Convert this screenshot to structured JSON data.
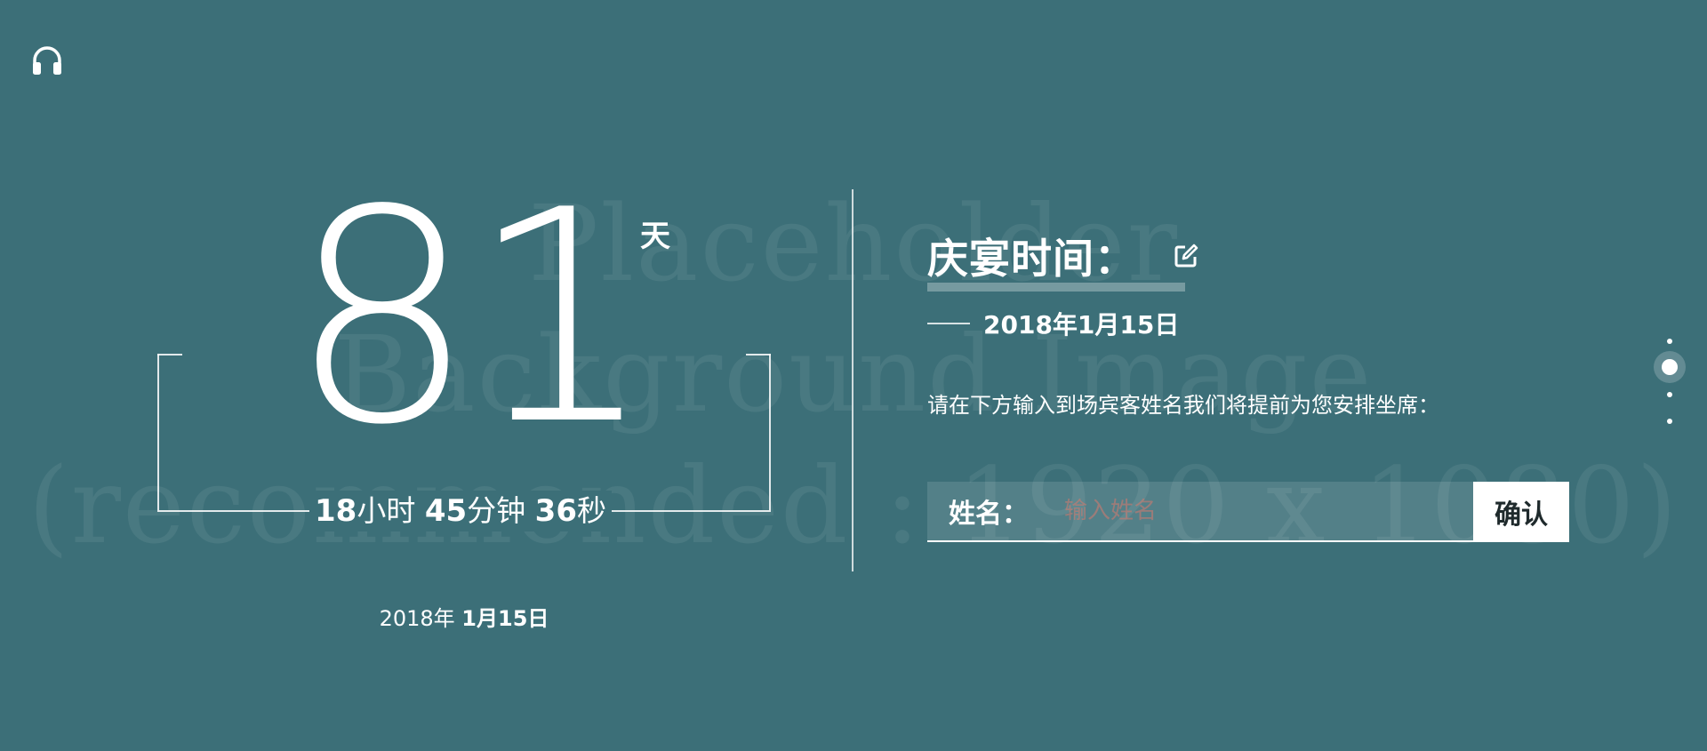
{
  "background": {
    "color": "#3c6f78",
    "placeholder_lines": [
      "Placeholder",
      "Background Image",
      "(recommended : 1920 x 1080)"
    ]
  },
  "music": {
    "icon": "headphones-icon"
  },
  "countdown": {
    "days": "81",
    "day_unit": "天",
    "hours": "18",
    "hours_unit": "小时",
    "minutes": "45",
    "minutes_unit": "分钟",
    "seconds": "36",
    "seconds_unit": "秒",
    "date_year": "2018年",
    "date_day": "1月15日"
  },
  "event": {
    "title": "庆宴时间：",
    "edit_icon": "edit-icon",
    "date": "2018年1月15日",
    "instruction": "请在下方输入到场宾客姓名我们将提前为您安排坐席："
  },
  "form": {
    "name_label": "姓名：",
    "name_placeholder": "输入姓名",
    "confirm_label": "确认"
  },
  "pagination": {
    "count": 4,
    "active_index": 1
  }
}
